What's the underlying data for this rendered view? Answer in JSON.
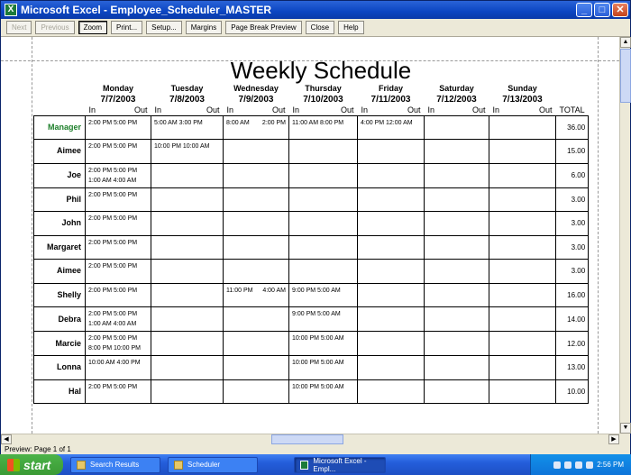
{
  "window": {
    "title": "Microsoft Excel - Employee_Scheduler_MASTER",
    "min": "_",
    "max": "□",
    "close": "✕"
  },
  "toolbar": {
    "next": "Next",
    "previous": "Previous",
    "zoom": "Zoom",
    "print": "Print...",
    "setup": "Setup...",
    "margins": "Margins",
    "page_break": "Page Break Preview",
    "close": "Close",
    "help": "Help"
  },
  "sheet": {
    "title": "Weekly Schedule",
    "days": [
      {
        "name": "Monday",
        "date": "7/7/2003"
      },
      {
        "name": "Tuesday",
        "date": "7/8/2003"
      },
      {
        "name": "Wednesday",
        "date": "7/9/2003"
      },
      {
        "name": "Thursday",
        "date": "7/10/2003"
      },
      {
        "name": "Friday",
        "date": "7/11/2003"
      },
      {
        "name": "Saturday",
        "date": "7/12/2003"
      },
      {
        "name": "Sunday",
        "date": "7/13/2003"
      }
    ],
    "in_label": "In",
    "out_label": "Out",
    "total_label": "TOTAL",
    "rows": [
      {
        "name": "Manager",
        "cells": [
          [
            "2:00 PM 5:00 PM"
          ],
          [
            "5:00 AM 3:00 PM"
          ],
          [
            "8:00 AM",
            "2:00 PM"
          ],
          [
            "11:00 AM 8:00 PM"
          ],
          [
            "4:00 PM 12:00 AM"
          ],
          [],
          []
        ],
        "total": "36.00"
      },
      {
        "name": "Aimee",
        "cells": [
          [
            "2:00 PM 5:00 PM"
          ],
          [
            "10:00 PM 10:00 AM"
          ],
          [],
          [],
          [],
          [],
          []
        ],
        "total": "15.00"
      },
      {
        "name": "Joe",
        "cells": [
          [
            "2:00 PM 5:00 PM",
            "1:00 AM 4:00 AM"
          ],
          [],
          [],
          [],
          [],
          [],
          []
        ],
        "total": "6.00"
      },
      {
        "name": "Phil",
        "cells": [
          [
            "2:00 PM 5:00 PM"
          ],
          [],
          [],
          [],
          [],
          [],
          []
        ],
        "total": "3.00"
      },
      {
        "name": "John",
        "cells": [
          [
            "2:00 PM 5:00 PM"
          ],
          [],
          [],
          [],
          [],
          [],
          []
        ],
        "total": "3.00"
      },
      {
        "name": "Margaret",
        "cells": [
          [
            "2:00 PM 5:00 PM"
          ],
          [],
          [],
          [],
          [],
          [],
          []
        ],
        "total": "3.00"
      },
      {
        "name": "Aimee",
        "cells": [
          [
            "2:00 PM 5:00 PM"
          ],
          [],
          [],
          [],
          [],
          [],
          []
        ],
        "total": "3.00"
      },
      {
        "name": "Shelly",
        "cells": [
          [
            "2:00 PM 5:00 PM"
          ],
          [],
          [
            "11:00 PM",
            "4:00 AM"
          ],
          [
            "9:00 PM 5:00 AM"
          ],
          [],
          [],
          []
        ],
        "total": "16.00"
      },
      {
        "name": "Debra",
        "cells": [
          [
            "2:00 PM 5:00 PM",
            "1:00 AM 4:00 AM"
          ],
          [],
          [],
          [
            "9:00 PM 5:00 AM"
          ],
          [],
          [],
          []
        ],
        "total": "14.00"
      },
      {
        "name": "Marcie",
        "cells": [
          [
            "2:00 PM 5:00 PM",
            "8:00 PM 10:00 PM"
          ],
          [],
          [],
          [
            "10:00 PM 5:00 AM"
          ],
          [],
          [],
          []
        ],
        "total": "12.00"
      },
      {
        "name": "Lonna",
        "cells": [
          [
            "10:00 AM 4:00 PM"
          ],
          [],
          [],
          [
            "10:00 PM 5:00 AM"
          ],
          [],
          [],
          []
        ],
        "total": "13.00"
      },
      {
        "name": "Hal",
        "cells": [
          [
            "2:00 PM 5:00 PM"
          ],
          [],
          [],
          [
            "10:00 PM 5:00 AM"
          ],
          [],
          [],
          []
        ],
        "total": "10.00"
      }
    ]
  },
  "status": {
    "text": "Preview: Page 1 of 1"
  },
  "taskbar": {
    "start": "start",
    "tasks": [
      "Search Results",
      "Scheduler",
      "Microsoft Excel - Empl..."
    ],
    "clock": "2:56 PM"
  },
  "colors": {
    "manager_label": "#1d7f2a",
    "title_bar": "#0b45c1",
    "taskbar": "#245edb",
    "start_button": "#3a9a35"
  }
}
